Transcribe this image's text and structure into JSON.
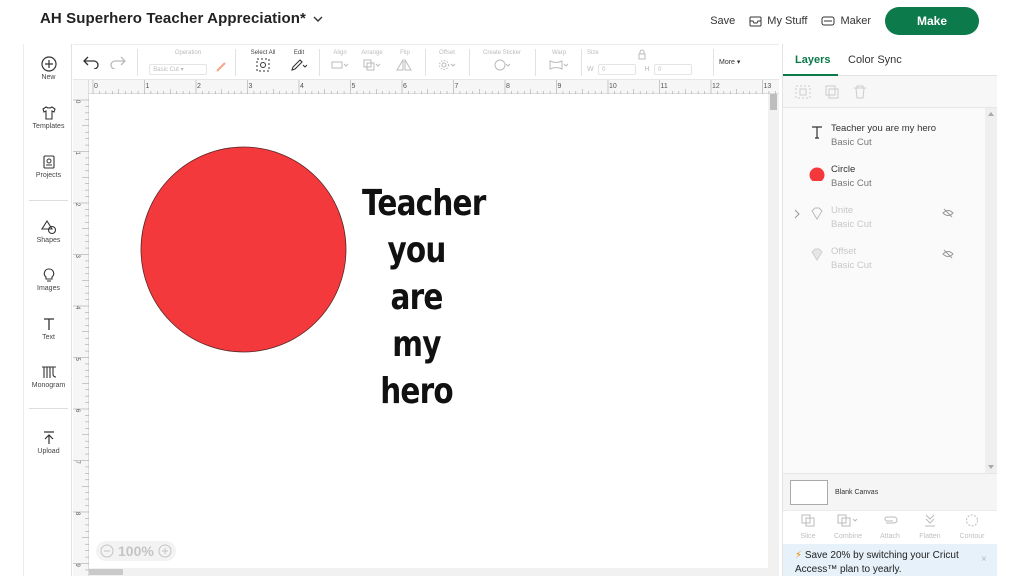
{
  "header": {
    "title": "AH Superhero Teacher Appreciation*",
    "save_label": "Save",
    "mystuff_label": "My Stuff",
    "maker_label": "Maker",
    "make_label": "Make"
  },
  "sidebar": {
    "items": [
      {
        "label": "New",
        "icon": "plus-circle-icon"
      },
      {
        "label": "Templates",
        "icon": "shirt-icon"
      },
      {
        "label": "Projects",
        "icon": "projects-icon"
      },
      {
        "label": "Shapes",
        "icon": "shapes-icon"
      },
      {
        "label": "Images",
        "icon": "lightbulb-icon"
      },
      {
        "label": "Text",
        "icon": "text-icon"
      },
      {
        "label": "Monogram",
        "icon": "monogram-icon"
      },
      {
        "label": "Upload",
        "icon": "upload-icon"
      }
    ]
  },
  "toolbar": {
    "operation_label": "Operation",
    "operation_value": "Basic Cut",
    "select_all_label": "Select All",
    "edit_label": "Edit",
    "align_label": "Align",
    "arrange_label": "Arrange",
    "flip_label": "Flip",
    "offset_label": "Offset",
    "sticker_label": "Create Sticker",
    "warp_label": "Warp",
    "size_label": "Size",
    "w_label": "W",
    "w_value": "0",
    "h_label": "H",
    "h_value": "0",
    "more_label": "More"
  },
  "canvas": {
    "ruler_top": [
      "0",
      "1",
      "2",
      "3",
      "4",
      "5",
      "6",
      "7",
      "8",
      "9",
      "10",
      "11",
      "12",
      "13"
    ],
    "ruler_left": [
      "0",
      "1",
      "2",
      "3",
      "4",
      "5",
      "6",
      "7",
      "8",
      "9"
    ],
    "zoom": "100%",
    "artwork_text_lines": [
      "Teacher",
      "you are",
      "my hero"
    ],
    "circle_color": "#f4393c"
  },
  "panel": {
    "tabs": [
      "Layers",
      "Color Sync"
    ],
    "layers": [
      {
        "name": "Teacher you are my hero",
        "sub": "Basic Cut",
        "icon": "text-t-icon",
        "dim": false
      },
      {
        "name": "Circle",
        "sub": "Basic Cut",
        "icon": "circle-icon",
        "dim": false
      },
      {
        "name": "Unite",
        "sub": "Basic Cut",
        "icon": "diamond-icon",
        "dim": true
      },
      {
        "name": "Offset",
        "sub": "Basic Cut",
        "icon": "diamond-icon",
        "dim": true
      }
    ],
    "blank_canvas_label": "Blank Canvas",
    "actions": [
      "Slice",
      "Combine",
      "Attach",
      "Flatten",
      "Contour"
    ],
    "promo_text": "Save 20% by switching your Cricut Access™ plan to yearly.",
    "promo_close": "×"
  },
  "colors": {
    "brand_green": "#0c7a4a",
    "circle_red": "#f4393c",
    "promo_bg": "#e6f1f9"
  }
}
